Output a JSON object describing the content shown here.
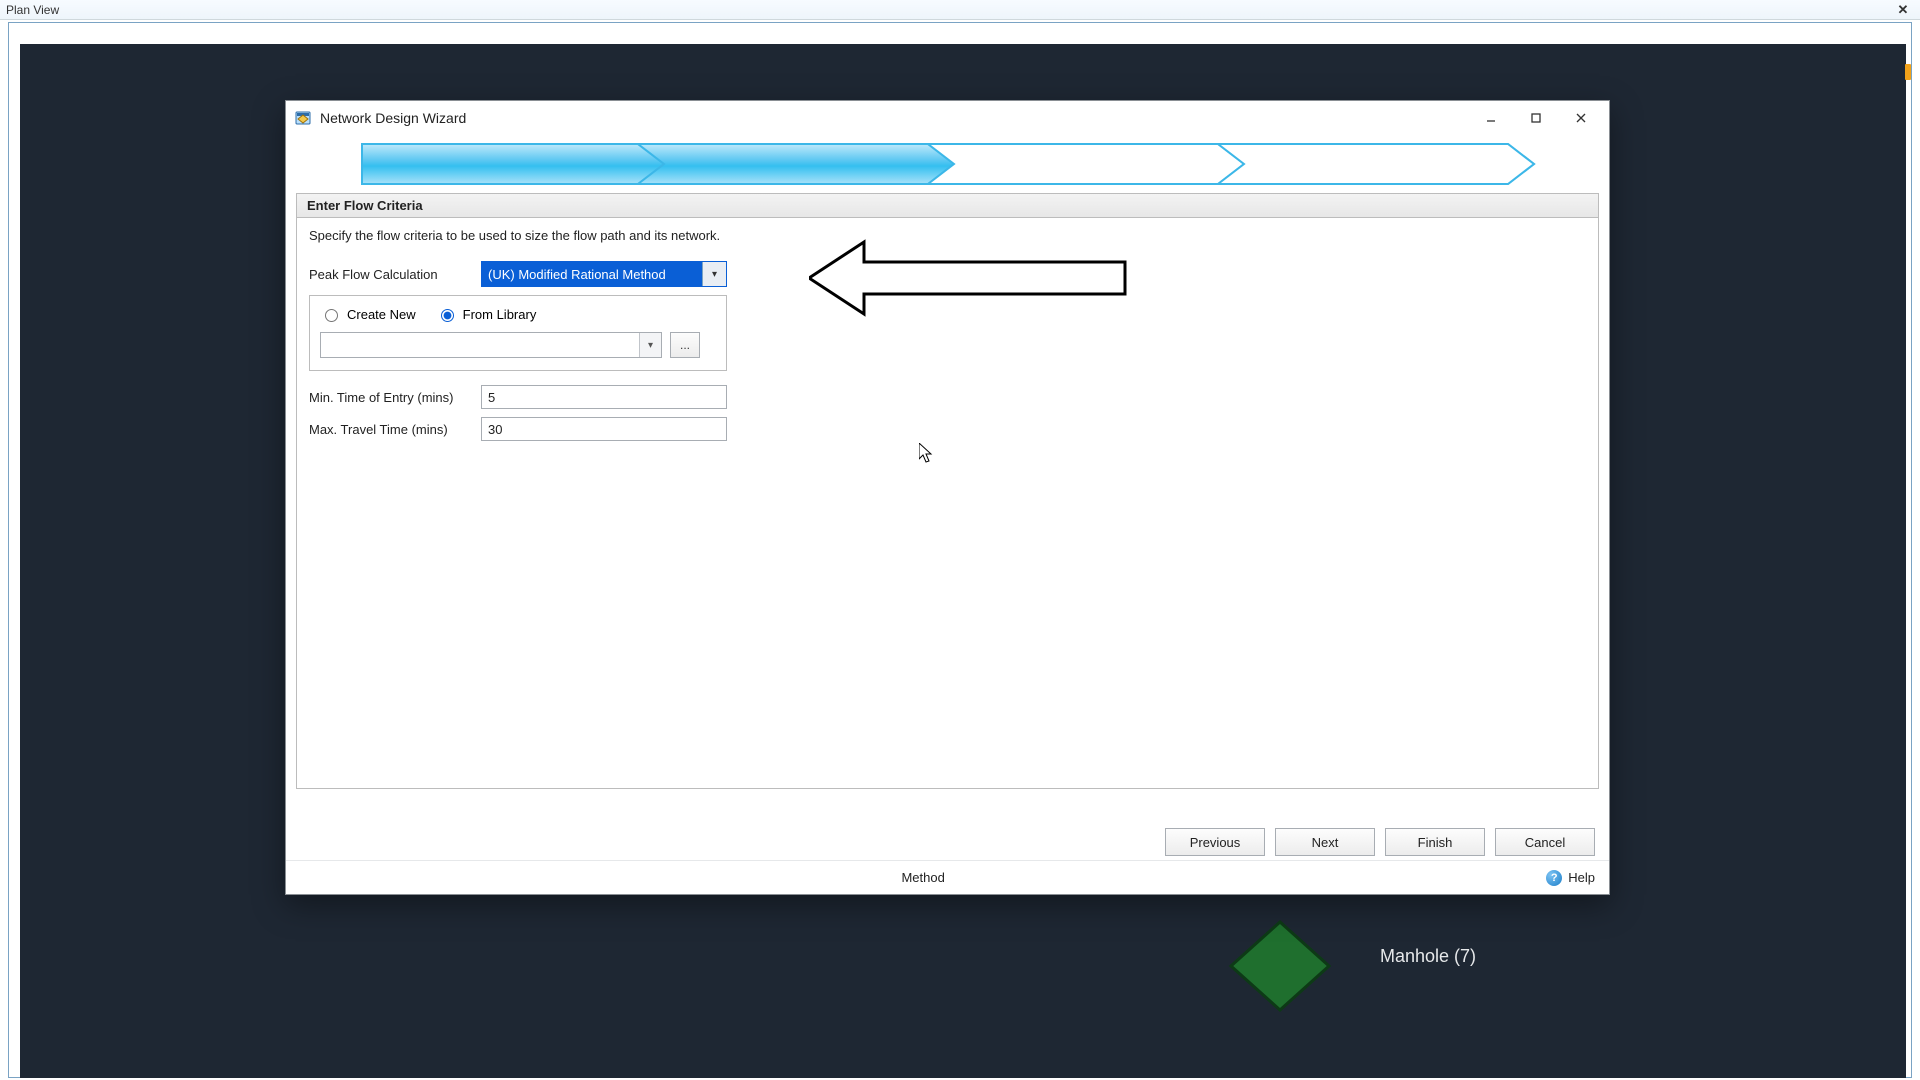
{
  "app": {
    "title": "Plan View"
  },
  "plan": {
    "manhole_label": "Manhole (7)"
  },
  "dialog": {
    "title": "Network Design Wizard",
    "section_title": "Enter Flow Criteria",
    "instruction": "Specify the flow criteria to be used to size the flow path and its network.",
    "peak_flow_label": "Peak Flow Calculation",
    "peak_flow_selected": "(UK) Modified Rational Method",
    "radio_create": "Create New",
    "radio_library": "From Library",
    "library_selected": "",
    "ellipsis": "...",
    "min_time_label": "Min. Time of Entry (mins)",
    "min_time_value": "5",
    "max_time_label": "Max. Travel Time (mins)",
    "max_time_value": "30",
    "buttons": {
      "previous": "Previous",
      "next": "Next",
      "finish": "Finish",
      "cancel": "Cancel"
    },
    "status_center": "Method",
    "help": "Help"
  }
}
